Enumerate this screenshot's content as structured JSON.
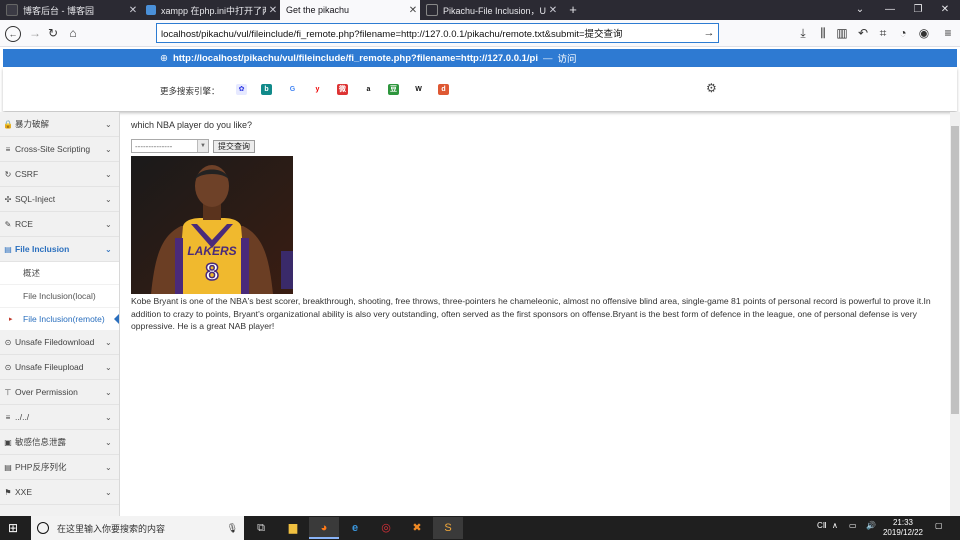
{
  "tabs": [
    {
      "title": "博客后台 - 博客园",
      "color": "#3b3a44"
    },
    {
      "title": "xampp 在php.ini中打开了两项",
      "color": "#4a90d9"
    },
    {
      "title": "Get the pikachu",
      "color": "#f9f9fb"
    },
    {
      "title": "Pikachu-File Inclusion，Unsafe",
      "color": "#e0a030"
    }
  ],
  "window": {
    "minimize": "—",
    "restore": "❐",
    "close": "✕",
    "new_tab": "+"
  },
  "address_bar": {
    "url": "localhost/pikachu/vul/fileinclude/fi_remote.php?filename=http://127.0.0.1/pikachu/remote.txt&submit=提交查询"
  },
  "suggestion": {
    "url": "http://localhost/pikachu/vul/fileinclude/fi_remote.php?filename=http://127.0.0.1/pi",
    "sep": "—",
    "action": "访问"
  },
  "search_engines": {
    "label": "更多搜索引擎：",
    "items": [
      {
        "name": "baidu-icon",
        "glyph": "✿",
        "color": "#2932e1",
        "bg": "#e6e9ff"
      },
      {
        "name": "bing-icon",
        "glyph": "b",
        "color": "#fff",
        "bg": "#118a8a"
      },
      {
        "name": "google-icon",
        "glyph": "G",
        "color": "#4285f4",
        "bg": "#fff"
      },
      {
        "name": "youdao-icon",
        "glyph": "y",
        "color": "#e00",
        "bg": "#fff"
      },
      {
        "name": "weibo-icon",
        "glyph": "微",
        "color": "#fff",
        "bg": "#d33"
      },
      {
        "name": "amazon-icon",
        "glyph": "a",
        "color": "#111",
        "bg": "#fff"
      },
      {
        "name": "douban-icon",
        "glyph": "豆",
        "color": "#fff",
        "bg": "#2e963d"
      },
      {
        "name": "wikipedia-icon",
        "glyph": "W",
        "color": "#111",
        "bg": "#fff"
      },
      {
        "name": "duckduckgo-icon",
        "glyph": "d",
        "color": "#fff",
        "bg": "#de5833"
      }
    ]
  },
  "sidebar": {
    "items": [
      {
        "icon": "🔒",
        "label": "暴力破解"
      },
      {
        "icon": "≡",
        "label": "Cross-Site Scripting"
      },
      {
        "icon": "↻",
        "label": "CSRF"
      },
      {
        "icon": "✣",
        "label": "SQL-Inject"
      },
      {
        "icon": "✎",
        "label": "RCE"
      },
      {
        "icon": "▤",
        "label": "File Inclusion"
      },
      {
        "icon": "⊙",
        "label": "Unsafe Filedownload"
      },
      {
        "icon": "⊙",
        "label": "Unsafe Fileupload"
      },
      {
        "icon": "⊤",
        "label": "Over Permission"
      },
      {
        "icon": "≡",
        "label": "../../"
      },
      {
        "icon": "▣",
        "label": "敏感信息泄露"
      },
      {
        "icon": "▤",
        "label": "PHP反序列化"
      },
      {
        "icon": "⚑",
        "label": "XXE"
      }
    ],
    "sub_items": [
      {
        "label": "概述"
      },
      {
        "label": "File Inclusion(local)"
      },
      {
        "label": "File Inclusion(remote)"
      }
    ]
  },
  "main": {
    "question": "which NBA player do you like?",
    "select_value": "--------------",
    "submit_label": "提交查询",
    "photo_jersey": "LAKERS",
    "photo_number": "8",
    "paragraph": "Kobe Bryant is one of the NBA's best scorer, breakthrough, shooting, free throws, three-pointers he chameleonic, almost no offensive blind area, single-game 81 points of personal record is powerful to prove it.In addition to crazy to points, Bryant's organizational ability is also very outstanding, often served as the first sponsors on offense.Bryant is the best form of defence in the league, one of personal defense is very oppressive. He is a great NAB player!"
  },
  "taskbar": {
    "search_placeholder": "在这里输入你要搜索的内容",
    "ime": "CⅡ",
    "time": "21:33",
    "date": "2019/12/22"
  }
}
